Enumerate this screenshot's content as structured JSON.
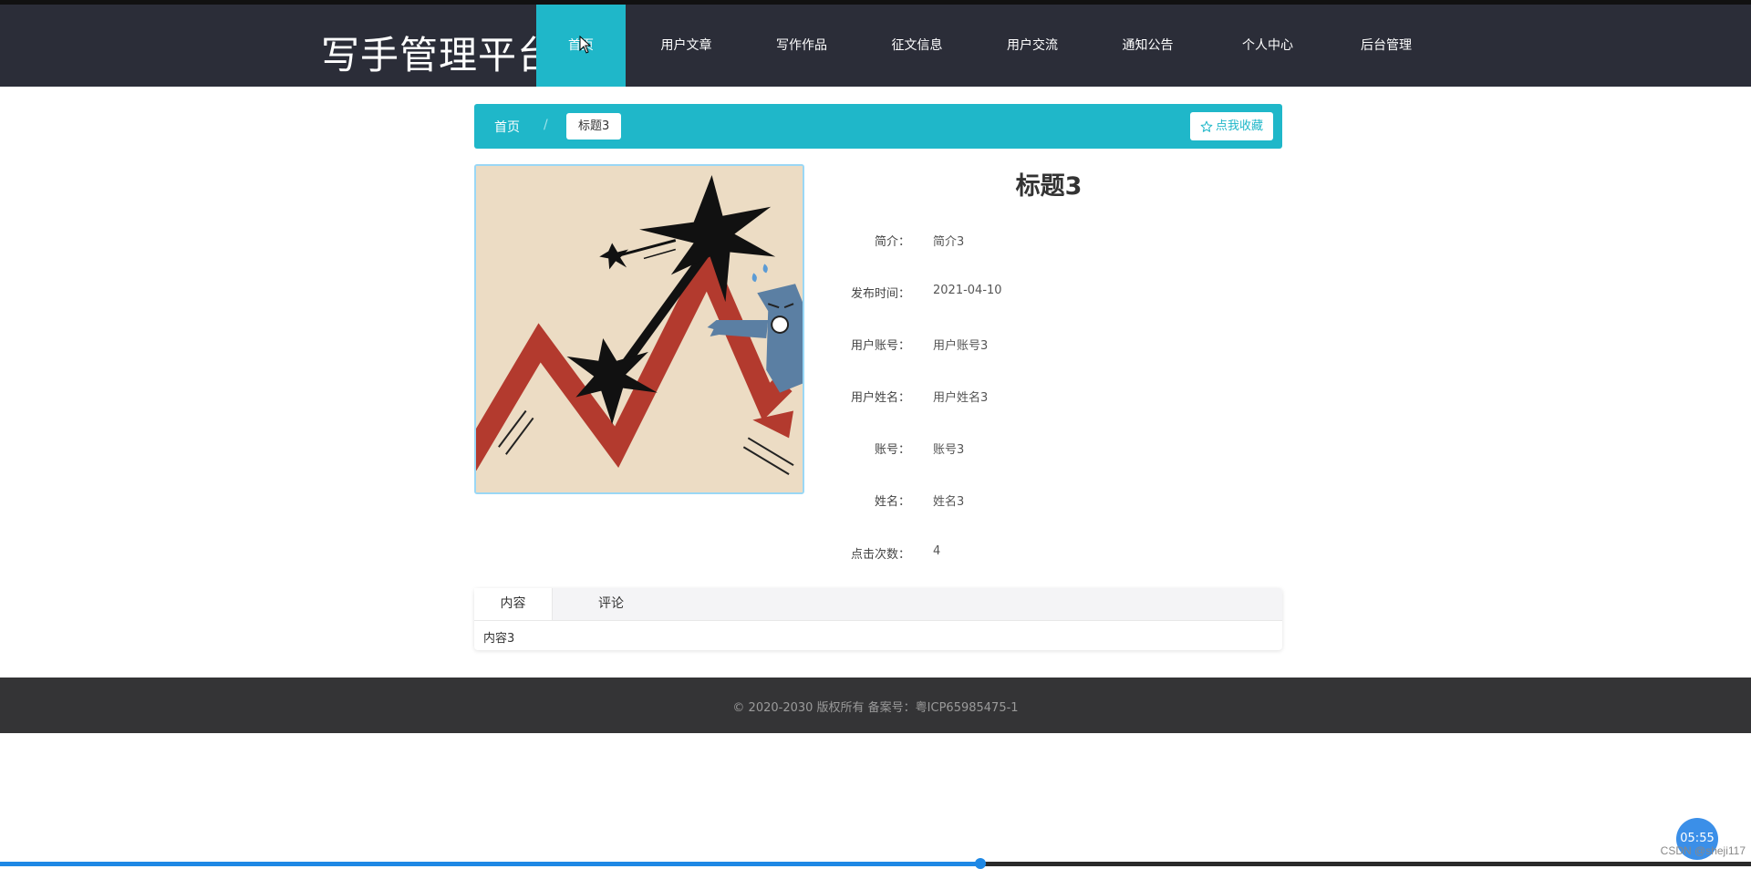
{
  "brand": {
    "title": "写手管理平台"
  },
  "nav": {
    "items": [
      {
        "label": "首页",
        "active": true
      },
      {
        "label": "用户文章",
        "active": false
      },
      {
        "label": "写作作品",
        "active": false
      },
      {
        "label": "征文信息",
        "active": false
      },
      {
        "label": "用户交流",
        "active": false
      },
      {
        "label": "通知公告",
        "active": false
      },
      {
        "label": "个人中心",
        "active": false
      },
      {
        "label": "后台管理",
        "active": false
      }
    ]
  },
  "breadcrumb": {
    "home": "首页",
    "separator": "/",
    "current": "标题3"
  },
  "favorite": {
    "label": "点我收藏",
    "icon": "star-outline-icon"
  },
  "detail": {
    "title": "标题3",
    "fields": [
      {
        "label": "简介：",
        "value": "简介3"
      },
      {
        "label": "发布时间：",
        "value": "2021-04-10"
      },
      {
        "label": "用户账号：",
        "value": "用户账号3"
      },
      {
        "label": "用户姓名：",
        "value": "用户姓名3"
      },
      {
        "label": "账号：",
        "value": "账号3"
      },
      {
        "label": "姓名：",
        "value": "姓名3"
      },
      {
        "label": "点击次数：",
        "value": "4"
      }
    ]
  },
  "tabs": {
    "items": [
      {
        "label": "内容",
        "active": true
      },
      {
        "label": "评论",
        "active": false
      }
    ],
    "content": "内容3"
  },
  "footer": {
    "text": "© 2020-2030 版权所有 备案号：粤ICP65985475-1"
  },
  "overlay": {
    "time": "05:55",
    "watermark": "CSDN @sheji117",
    "progress": 0.56
  },
  "colors": {
    "accent": "#1fb7c9",
    "header_bg": "#2b2d38",
    "footer_bg": "#343436"
  }
}
